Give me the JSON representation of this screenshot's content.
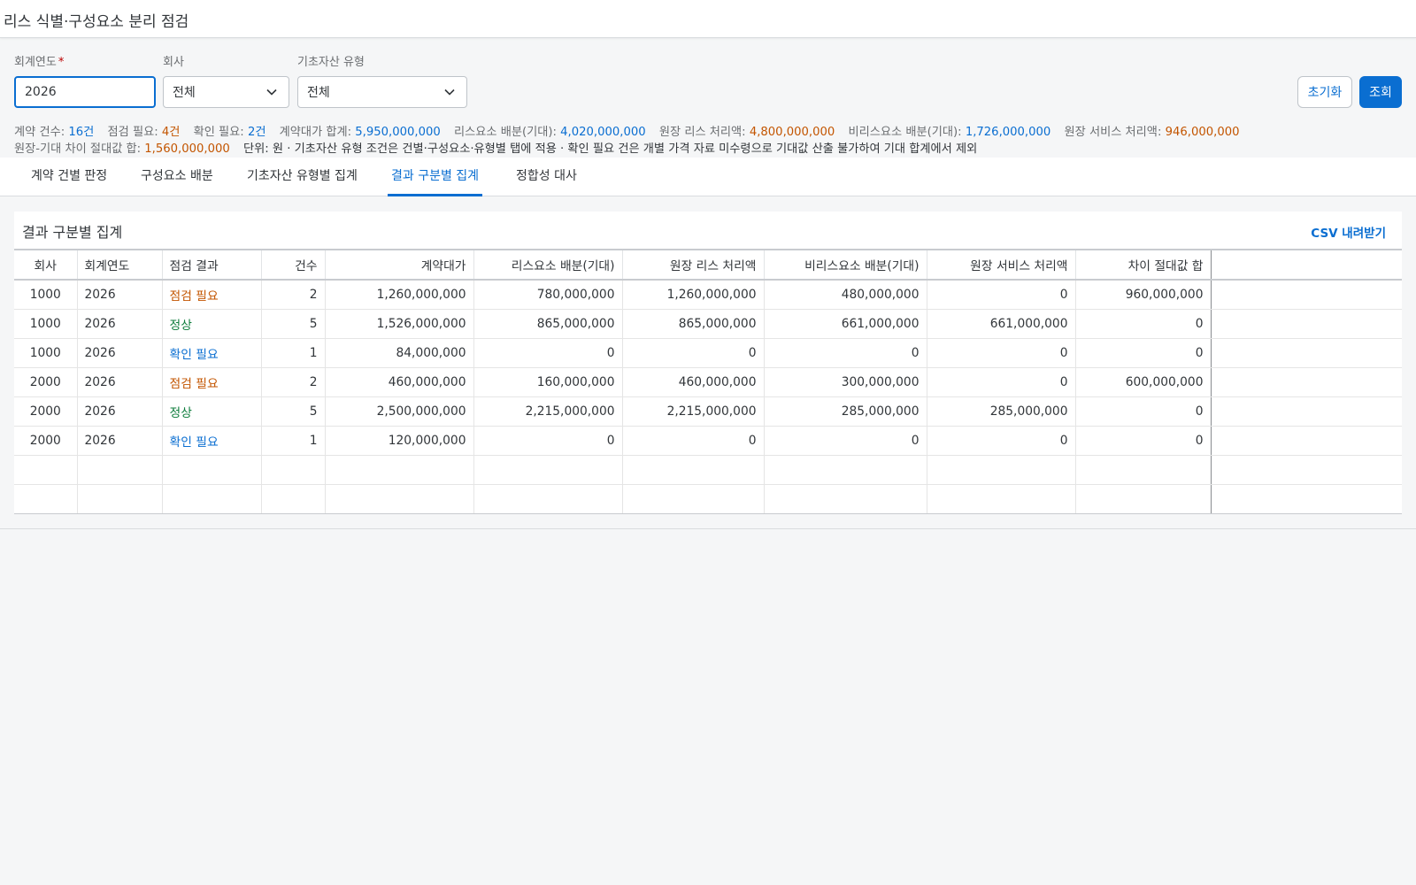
{
  "header": {
    "title": "리스 식별·구성요소 분리 점검"
  },
  "filters": {
    "fiscal_year": {
      "label": "회계연도",
      "required_mark": "*",
      "value": "2026"
    },
    "company": {
      "label": "회사",
      "value": "전체"
    },
    "asset_type": {
      "label": "기초자산 유형",
      "value": "전체"
    }
  },
  "buttons": {
    "reset": "초기화",
    "search": "조회"
  },
  "summary": [
    {
      "label": "계약 건수: ",
      "value": "16건",
      "color": "blue"
    },
    {
      "label": "점검 필요: ",
      "value": "4건",
      "color": "orange"
    },
    {
      "label": "확인 필요: ",
      "value": "2건",
      "color": "blue"
    },
    {
      "label": "계약대가 합계: ",
      "value": "5,950,000,000",
      "color": "blue"
    },
    {
      "label": "리스요소 배분(기대): ",
      "value": "4,020,000,000",
      "color": "blue"
    },
    {
      "label": "원장 리스 처리액: ",
      "value": "4,800,000,000",
      "color": "orange"
    },
    {
      "label": "비리스요소 배분(기대): ",
      "value": "1,726,000,000",
      "color": "blue"
    },
    {
      "label": "원장 서비스 처리액: ",
      "value": "946,000,000",
      "color": "orange"
    },
    {
      "label": "원장-기대 차이 절대값 합: ",
      "value": "1,560,000,000",
      "color": "orange"
    }
  ],
  "summary_note": "단위: 원 · 기초자산 유형 조건은 건별·구성요소·유형별 탭에 적용 · 확인 필요 건은 개별 가격 자료 미수령으로 기대값 산출 불가하여 기대 합계에서 제외",
  "tabs": [
    {
      "label": "계약 건별 판정",
      "active": false
    },
    {
      "label": "구성요소 배분",
      "active": false
    },
    {
      "label": "기초자산 유형별 집계",
      "active": false
    },
    {
      "label": "결과 구분별 집계",
      "active": true
    },
    {
      "label": "정합성 대사",
      "active": false
    }
  ],
  "panel": {
    "title": "결과 구분별 집계",
    "csv_label": "CSV 내려받기"
  },
  "table": {
    "columns": [
      "회사",
      "회계연도",
      "점검 결과",
      "건수",
      "계약대가",
      "리스요소 배분(기대)",
      "원장 리스 처리액",
      "비리스요소 배분(기대)",
      "원장 서비스 처리액",
      "차이 절대값 합"
    ],
    "rows": [
      {
        "company": "1000",
        "year": "2026",
        "result": "점검 필요",
        "status": "orange",
        "count": "2",
        "consideration": "1,260,000,000",
        "lease_expected": "780,000,000",
        "ledger_lease": "1,260,000,000",
        "nonlease_expected": "480,000,000",
        "ledger_service": "0",
        "diff_abs": "960,000,000"
      },
      {
        "company": "1000",
        "year": "2026",
        "result": "정상",
        "status": "green",
        "count": "5",
        "consideration": "1,526,000,000",
        "lease_expected": "865,000,000",
        "ledger_lease": "865,000,000",
        "nonlease_expected": "661,000,000",
        "ledger_service": "661,000,000",
        "diff_abs": "0"
      },
      {
        "company": "1000",
        "year": "2026",
        "result": "확인 필요",
        "status": "blue",
        "count": "1",
        "consideration": "84,000,000",
        "lease_expected": "0",
        "ledger_lease": "0",
        "nonlease_expected": "0",
        "ledger_service": "0",
        "diff_abs": "0"
      },
      {
        "company": "2000",
        "year": "2026",
        "result": "점검 필요",
        "status": "orange",
        "count": "2",
        "consideration": "460,000,000",
        "lease_expected": "160,000,000",
        "ledger_lease": "460,000,000",
        "nonlease_expected": "300,000,000",
        "ledger_service": "0",
        "diff_abs": "600,000,000"
      },
      {
        "company": "2000",
        "year": "2026",
        "result": "정상",
        "status": "green",
        "count": "5",
        "consideration": "2,500,000,000",
        "lease_expected": "2,215,000,000",
        "ledger_lease": "2,215,000,000",
        "nonlease_expected": "285,000,000",
        "ledger_service": "285,000,000",
        "diff_abs": "0"
      },
      {
        "company": "2000",
        "year": "2026",
        "result": "확인 필요",
        "status": "blue",
        "count": "1",
        "consideration": "120,000,000",
        "lease_expected": "0",
        "ledger_lease": "0",
        "nonlease_expected": "0",
        "ledger_service": "0",
        "diff_abs": "0"
      }
    ],
    "empty_rows": 2
  },
  "colors": {
    "accent": "#0a6ed1",
    "warning": "#c35500",
    "success": "#107e3e",
    "required": "#bb0000"
  },
  "icons": {
    "dropdown": "chevron-down-icon"
  }
}
